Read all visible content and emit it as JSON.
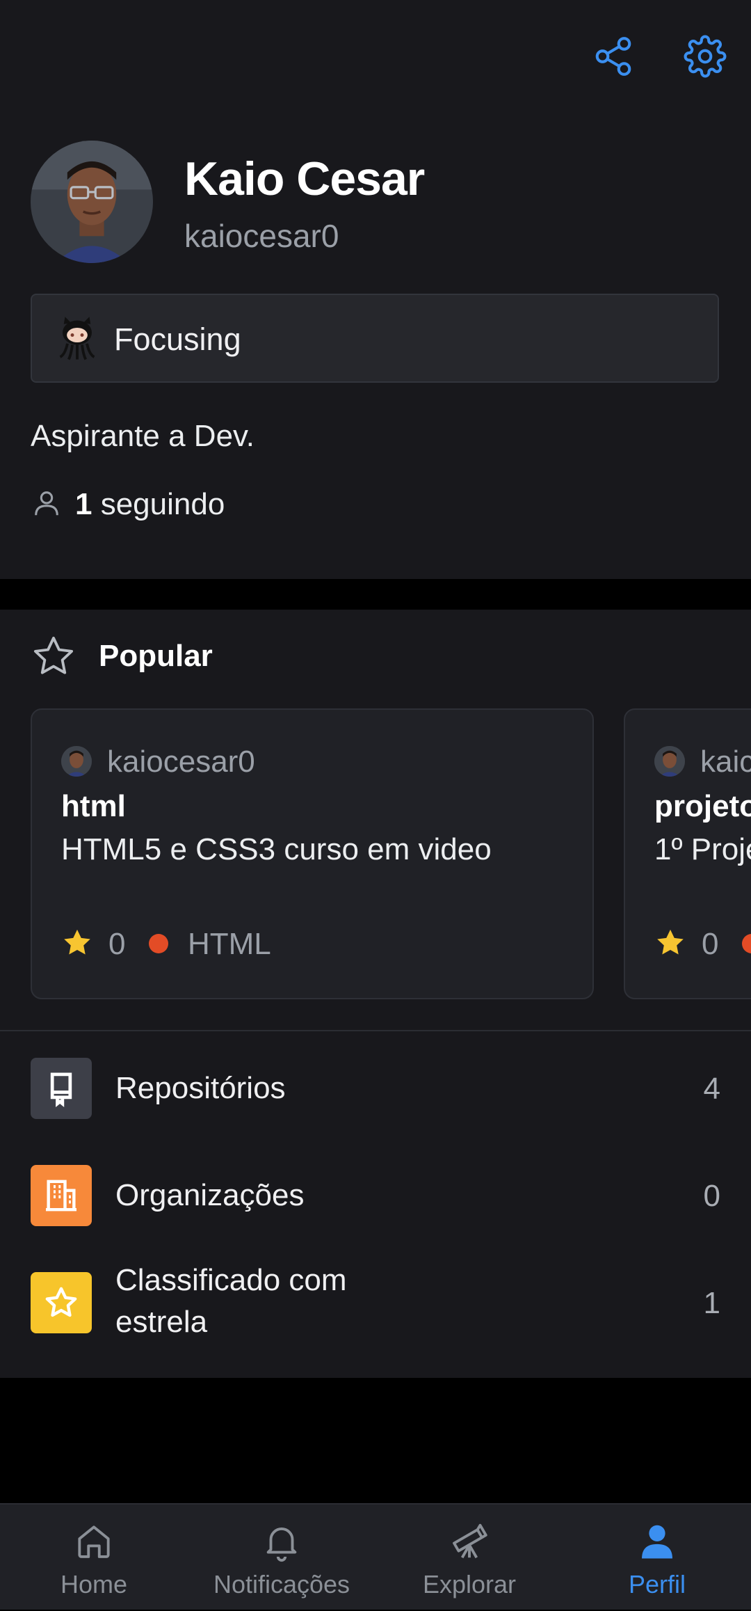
{
  "colors": {
    "accent": "#3b8ff0",
    "background": "#18181c",
    "card": "#202126",
    "html_lang": "#e34c26",
    "star": "#f7c531",
    "repos_icon_bg": "#3d3f48",
    "orgs_icon_bg": "#f7893a",
    "starred_icon_bg": "#f7c52b"
  },
  "header": {
    "share_icon": "share-icon",
    "settings_icon": "gear-icon"
  },
  "profile": {
    "name": "Kaio Cesar",
    "login": "kaiocesar0",
    "status_text": "Focusing",
    "bio": "Aspirante a Dev.",
    "following_count": "1",
    "following_label": " seguindo"
  },
  "popular": {
    "title": "Popular",
    "cards": [
      {
        "owner": "kaiocesar0",
        "repo": "html",
        "description": "HTML5 e CSS3 curso em video",
        "stars": "0",
        "language": "HTML"
      },
      {
        "owner": "kaic",
        "repo": "projeto",
        "description": "1º Proje",
        "stars": "0",
        "language": ""
      }
    ]
  },
  "menu": [
    {
      "label": "Repositórios",
      "count": "4",
      "icon": "repo-icon"
    },
    {
      "label": "Organizações",
      "count": "0",
      "icon": "organization-icon"
    },
    {
      "label": "Classificado com estrela",
      "count": "1",
      "icon": "star-icon"
    }
  ],
  "bottom_nav": [
    {
      "label": "Home",
      "icon": "home-icon",
      "active": false
    },
    {
      "label": "Notificações",
      "icon": "bell-icon",
      "active": false
    },
    {
      "label": "Explorar",
      "icon": "telescope-icon",
      "active": false
    },
    {
      "label": "Perfil",
      "icon": "person-icon",
      "active": true
    }
  ]
}
